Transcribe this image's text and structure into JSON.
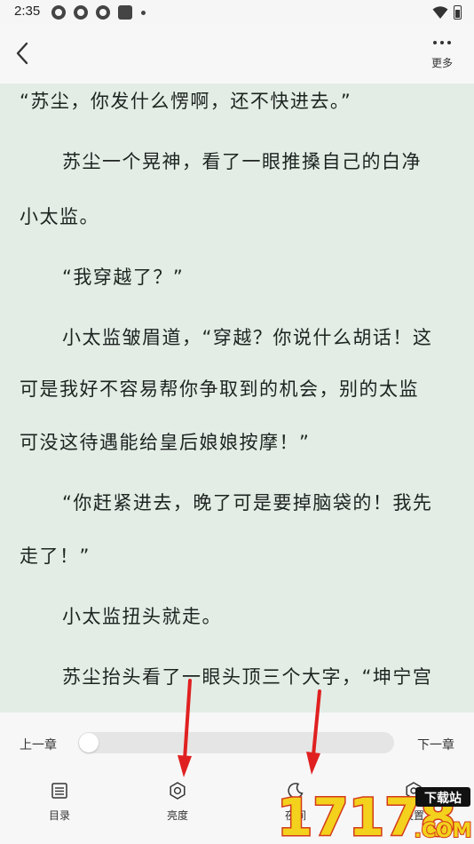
{
  "status_bar": {
    "time": "2:35",
    "icons": [
      "notification-icon",
      "notification-icon",
      "notification-icon",
      "square-icon",
      "dot-icon",
      "wifi-icon",
      "battery-icon"
    ]
  },
  "top_bar": {
    "back_icon": "chevron-left-icon",
    "more_icon": "more-dots-icon",
    "more_label": "更多"
  },
  "content": {
    "lines": [
      "“苏尘，你发什么愣啊，还不快进去。”",
      "苏尘一个晃神，看了一眼推搡自己的白净",
      "小太监。",
      "“我穿越了？”",
      "小太监皱眉道，“穿越？你说什么胡话！这",
      "可是我好不容易帮你争取到的机会，别的太监",
      "可没这待遇能给皇后娘娘按摩！”",
      "“你赶紧进去，晚了可是要掉脑袋的！我先",
      "走了！”",
      "小太监扭头就走。",
      "苏尘抬头看了一眼头顶三个大字，“坤宁宫"
    ]
  },
  "bottom_panel": {
    "prev_chapter": "上一章",
    "next_chapter": "下一章",
    "progress": 0.0,
    "nav": [
      {
        "label": "目录",
        "icon": "list-icon"
      },
      {
        "label": "亮度",
        "icon": "brightness-icon"
      },
      {
        "label": "夜间",
        "icon": "moon-icon"
      },
      {
        "label": "设置",
        "icon": "settings-icon"
      }
    ]
  },
  "watermark": {
    "text": "17178",
    "sub_top": "下载站",
    "sub_bottom": ".COM"
  },
  "colors": {
    "reading_bg": "#e4ece6",
    "panel_bg": "#f7f7f7",
    "text": "#1d2420",
    "arrow": "#e02020"
  }
}
